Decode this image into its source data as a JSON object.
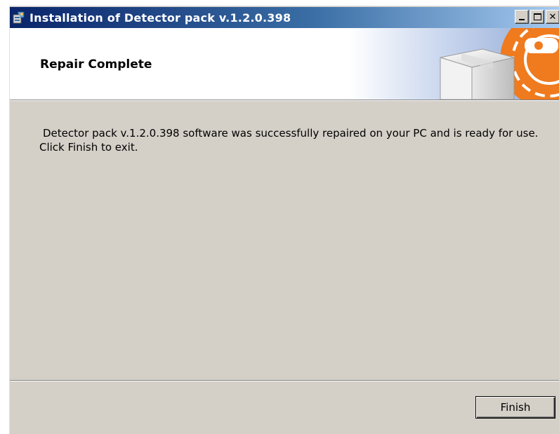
{
  "window": {
    "title": "Installation of Detector pack v.1.2.0.398",
    "icon": "installer-icon"
  },
  "title_buttons": {
    "minimize": "minimize-icon",
    "maximize": "maximize-icon",
    "close": "close-icon",
    "close_glyph": "✕"
  },
  "header": {
    "title": "Repair Complete",
    "art_icon": "software-box-icon"
  },
  "body": {
    "message": "Detector pack v.1.2.0.398 software was successfully repaired on your PC and is ready for use. Click Finish to exit."
  },
  "footer": {
    "finish_label": "Finish"
  },
  "colors": {
    "titlebar_start": "#0a246a",
    "titlebar_end": "#a6caf0",
    "dialog_bg": "#d4d0c8",
    "accent_orange": "#f07a1e"
  }
}
